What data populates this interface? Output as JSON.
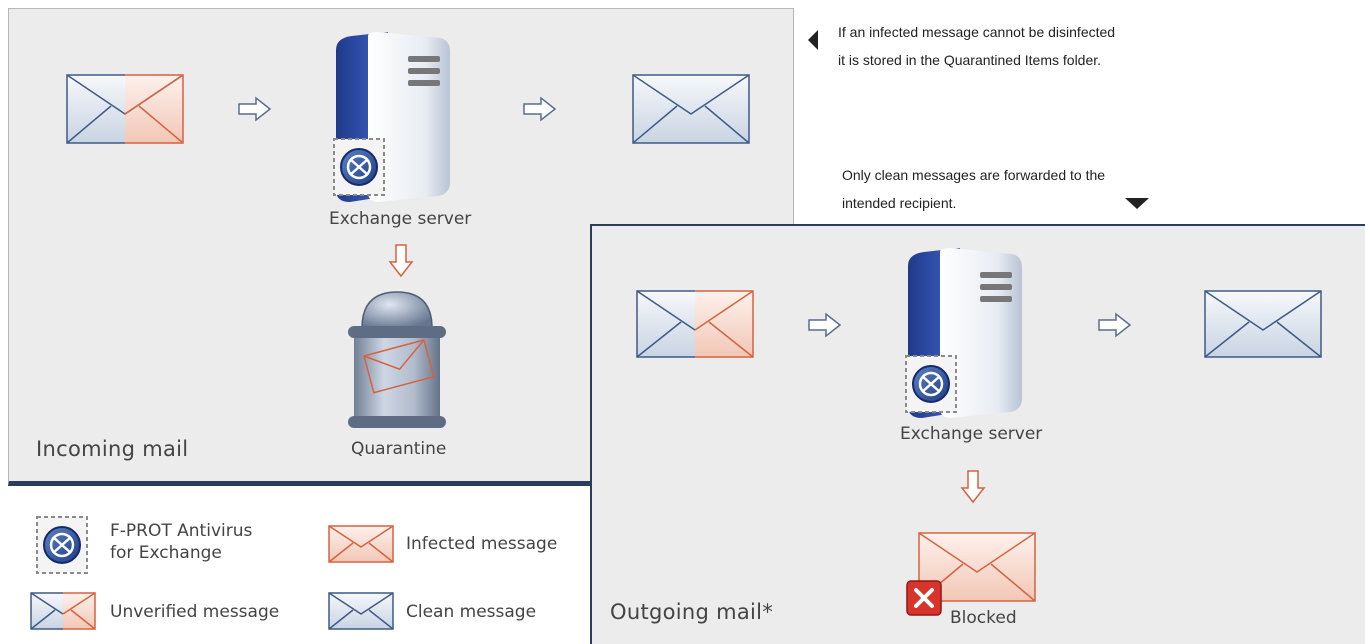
{
  "header_fragment": "",
  "notes": {
    "quarantine_note_line1": "If an infected message cannot be disinfected",
    "quarantine_note_line2": "it is stored in the Quarantined Items folder.",
    "clean_note_line1": "Only clean messages are forwarded to the",
    "clean_note_line2": "intended recipient."
  },
  "incoming": {
    "title": "Incoming mail",
    "server_label": "Exchange server",
    "quarantine_label": "Quarantine"
  },
  "outgoing": {
    "title": "Outgoing mail*",
    "server_label": "Exchange server",
    "blocked_label": "Blocked"
  },
  "legend": {
    "fprot_line1": "F-PROT Antivirus",
    "fprot_line2": "for Exchange",
    "infected": "Infected message",
    "unverified": "Unverified message",
    "clean": "Clean message"
  },
  "colors": {
    "clean_stroke": "#3e5a86",
    "infected_stroke": "#d6623f",
    "panel_border": "#2b3d5c",
    "server_blue": "#2f4fa8",
    "blocked_red": "#d9342b"
  }
}
